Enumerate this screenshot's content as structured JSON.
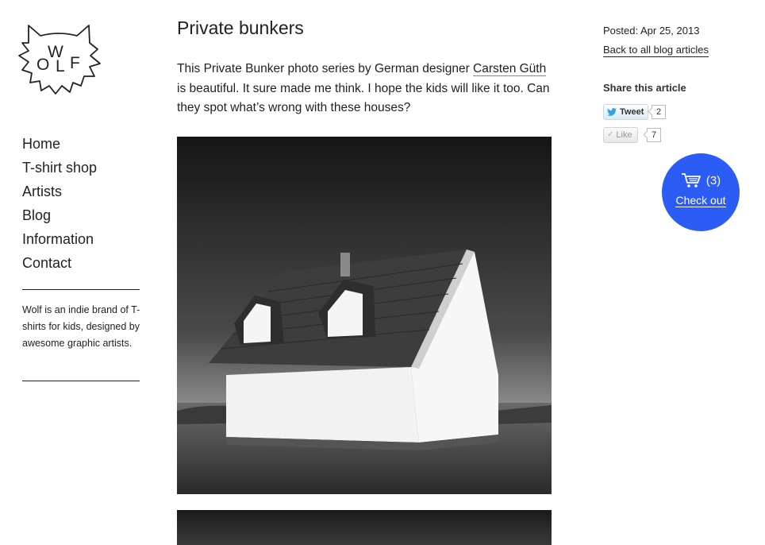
{
  "logo": {
    "letters": [
      "W",
      "O",
      "L",
      "F"
    ]
  },
  "nav": [
    {
      "label": "Home"
    },
    {
      "label": "T-shirt shop"
    },
    {
      "label": "Artists"
    },
    {
      "label": "Blog"
    },
    {
      "label": "Information"
    },
    {
      "label": "Contact"
    }
  ],
  "blurb": "Wolf is an indie brand of T-shirts for kids, designed by awesome graphic artists.",
  "article": {
    "title": "Private bunkers",
    "intro_before": "This Private Bunker photo series by German designer ",
    "intro_link": "Carsten Güth",
    "intro_after": " is beautiful. It sure made me think. I hope the kids will like it too. Can they spot what’s wrong with these houses?"
  },
  "sidebar": {
    "posted": "Posted: Apr 25, 2013",
    "back_link": "Back to all blog articles",
    "share_heading": "Share this article",
    "tweet_label": "Tweet",
    "tweet_count": "2",
    "like_label": "Like",
    "like_count": "7"
  },
  "cart": {
    "count": "(3)",
    "checkout_label": "Check out",
    "color": "#2b5cf5"
  },
  "icons": {
    "twitter": "twitter-bird-icon",
    "like": "checkmark-icon",
    "cart": "shopping-cart-icon"
  }
}
